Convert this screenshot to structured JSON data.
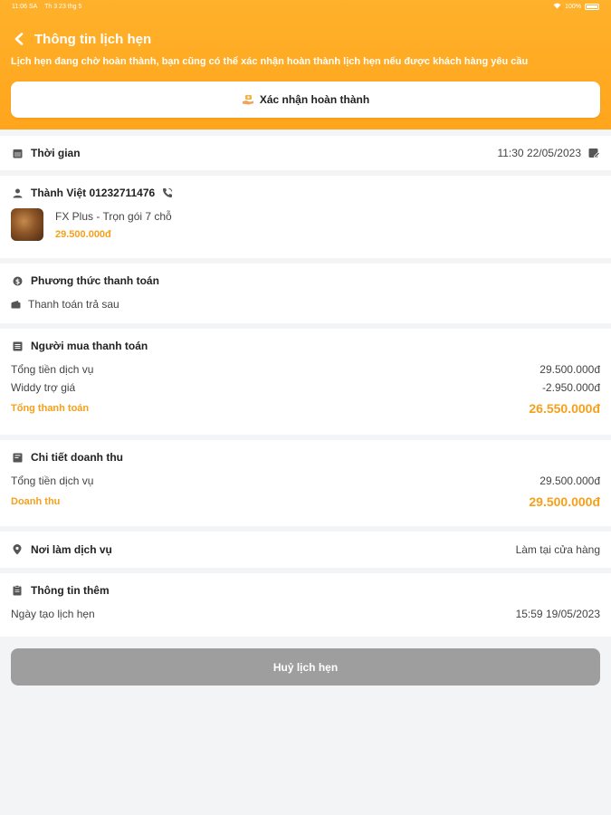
{
  "status_bar": {
    "time": "11:06 SA",
    "date": "Th 3 23 thg 5",
    "battery": "100%"
  },
  "header": {
    "title": "Thông tin lịch hẹn",
    "notice": "Lịch hẹn đang chờ hoàn thành, bạn cũng có thể xác nhận hoàn thành lịch hẹn nếu được khách hàng yêu cầu",
    "confirm_label": "Xác nhận hoàn thành"
  },
  "time_section": {
    "label": "Thời gian",
    "value": "11:30 22/05/2023"
  },
  "customer": {
    "name_phone": "Thành Việt 01232711476",
    "product_name": "FX Plus - Trọn gói 7 chỗ",
    "product_price": "29.500.000đ"
  },
  "payment_method": {
    "label": "Phương thức thanh toán",
    "value": "Thanh toán trả sau"
  },
  "buyer_payment": {
    "label": "Người mua thanh toán",
    "rows": [
      {
        "label": "Tổng tiền dịch vụ",
        "value": "29.500.000đ"
      },
      {
        "label": "Widdy trợ giá",
        "value": "-2.950.000đ"
      }
    ],
    "total_label": "Tổng thanh toán",
    "total_value": "26.550.000đ"
  },
  "revenue": {
    "label": "Chi tiết doanh thu",
    "rows": [
      {
        "label": "Tổng tiền dịch vụ",
        "value": "29.500.000đ"
      }
    ],
    "total_label": "Doanh thu",
    "total_value": "29.500.000đ"
  },
  "place": {
    "label": "Nơi làm dịch vụ",
    "value": "Làm tại cửa hàng"
  },
  "extra_info": {
    "label": "Thông tin thêm",
    "created_label": "Ngày tạo lịch hẹn",
    "created_value": "15:59 19/05/2023"
  },
  "cancel_label": "Huỷ lịch hẹn",
  "colors": {
    "accent": "#ffa51c",
    "price": "#f5a01a",
    "cancel_button": "#9e9e9e",
    "background": "#f3f4f6"
  }
}
